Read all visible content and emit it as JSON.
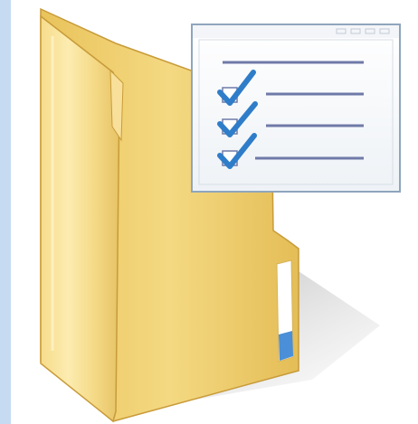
{
  "icon": {
    "name": "folder-with-checklist-icon",
    "checked_items": 3
  },
  "colors": {
    "background_strip": "#c6dbf1",
    "background": "#ffffff",
    "folder_front_light": "#fbe9a6",
    "folder_front_mid": "#f2d57a",
    "folder_front_dark": "#e2bc55",
    "folder_back": "#f0cf6e",
    "folder_edge": "#c89b3a",
    "tab_white": "#ffffff",
    "tab_blue": "#4a8fd8",
    "doc_border": "#8fa5bd",
    "doc_fill": "#f7f9fb",
    "line_color": "#6f7aa8",
    "check_color": "#2f7dc9"
  }
}
